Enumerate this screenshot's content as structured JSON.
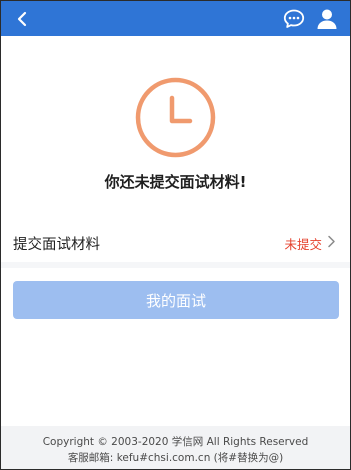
{
  "header": {
    "background": "#2f75d6",
    "back_icon": "chevron-left-icon",
    "chat_icon": "chat-bubble-icon",
    "user_icon": "user-icon"
  },
  "status": {
    "icon": "clock-icon",
    "icon_color": "#f09a6e",
    "message": "你还未提交面试材料!"
  },
  "materials_row": {
    "label": "提交面试材料",
    "status": "未提交",
    "status_color": "#e5412d"
  },
  "primary_button": {
    "label": "我的面试",
    "color": "#9dbef0"
  },
  "footer": {
    "copyright": "Copyright © 2003-2020 学信网 All Rights Reserved",
    "contact": "客服邮箱: kefu#chsi.com.cn (将#替换为@)"
  }
}
